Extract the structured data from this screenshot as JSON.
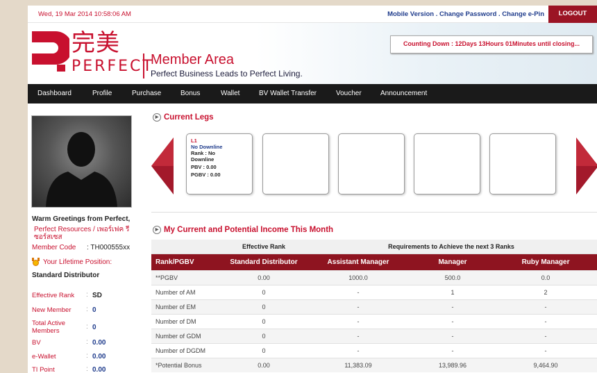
{
  "topbar": {
    "date": "Wed, 19 Mar 2014   10:58:06 AM",
    "links": "Mobile Version . Change Password . Change e-Pin",
    "logout": "LOGOUT"
  },
  "header": {
    "logo_cn": "完美",
    "logo_en": "PERFECT",
    "title": "Member Area",
    "tagline": "Perfect Business Leads to Perfect Living.",
    "countdown": "Counting Down : 12Days 13Hours 01Minutes until closing..."
  },
  "nav": [
    "Dashboard",
    "Profile",
    "Purchase",
    "Bonus",
    "Wallet",
    "BV Wallet Transfer",
    "Voucher",
    "Announcement"
  ],
  "sidebar": {
    "greeting": "Warm Greetings from Perfect,",
    "resources": "Perfect Resources / เพอร์เฟค รีซอร์สเซส",
    "member_code_label": "Member Code",
    "member_code_value": ": TH000555xx",
    "lifetime_label": "Your Lifetime Position:",
    "lifetime_value": "Standard Distributor",
    "stats": [
      {
        "label": "Effective Rank",
        "value": "SD"
      },
      {
        "label": "New Member",
        "value": "0"
      },
      {
        "label": "Total Active Members",
        "value": "0"
      },
      {
        "label": "BV",
        "value": "0.00"
      },
      {
        "label": "e-Wallet",
        "value": "0.00"
      },
      {
        "label": "TI Point",
        "value": "0.00"
      }
    ]
  },
  "legs": {
    "title": "Current Legs",
    "leg1": {
      "code": "L1",
      "downline": "No Downline",
      "rank": "Rank : No Downline",
      "pbv": "PBV : 0.00",
      "pgbv": "PGBV : 0.00"
    }
  },
  "income": {
    "title": "My Current and Potential Income This Month",
    "effective_rank_caption": "Effective Rank",
    "requirements_caption": "Requirements to Achieve the next 3 Ranks",
    "headers": [
      "Rank/PGBV",
      "Standard Distributor",
      "Assistant Manager",
      "Manager",
      "Ruby Manager"
    ],
    "rows": [
      [
        "**PGBV",
        "0.00",
        "1000.0",
        "500.0",
        "0.0"
      ],
      [
        "Number of AM",
        "0",
        "-",
        "1",
        "2"
      ],
      [
        "Number of EM",
        "0",
        "-",
        "-",
        "-"
      ],
      [
        "Number of DM",
        "0",
        "-",
        "-",
        "-"
      ],
      [
        "Number of GDM",
        "0",
        "-",
        "-",
        "-"
      ],
      [
        "Number of DGDM",
        "0",
        "-",
        "-",
        "-"
      ],
      [
        "*Potential Bonus",
        "0.00",
        "11,383.09",
        "13,989.96",
        "9,464.90"
      ]
    ]
  },
  "colors": {
    "brand_red": "#c8102e",
    "header_dark_red": "#8e1420",
    "nav_black": "#1a1a1a",
    "link_blue": "#1f3c8c"
  }
}
